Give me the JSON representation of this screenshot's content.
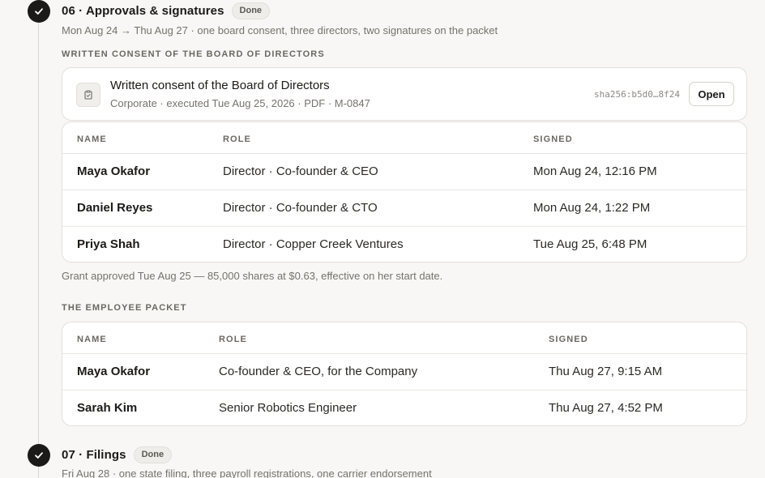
{
  "step06": {
    "title": "06 · Approvals & signatures",
    "badge": "Done",
    "subtitle": "Mon Aug 24 → Thu Aug 27 · one board consent, three directors, two signatures on the packet"
  },
  "board_section": {
    "label": "WRITTEN CONSENT OF THE BOARD OF DIRECTORS",
    "doc": {
      "icon": "clipboard-check-icon",
      "title": "Written consent of the Board of Directors",
      "meta": "Corporate · executed Tue Aug 25, 2026 · PDF · M-0847",
      "hash": "sha256:b5d0…8f24",
      "open_label": "Open"
    },
    "columns": [
      "NAME",
      "ROLE",
      "SIGNED"
    ],
    "rows": [
      {
        "name": "Maya Okafor",
        "role": "Director · Co-founder & CEO",
        "signed": "Mon Aug 24, 12:16 PM"
      },
      {
        "name": "Daniel Reyes",
        "role": "Director · Co-founder & CTO",
        "signed": "Mon Aug 24, 1:22 PM"
      },
      {
        "name": "Priya Shah",
        "role": "Director · Copper Creek Ventures",
        "signed": "Tue Aug 25, 6:48 PM"
      }
    ],
    "note": "Grant approved Tue Aug 25 — 85,000 shares at $0.63, effective on her start date."
  },
  "packet_section": {
    "label": "THE EMPLOYEE PACKET",
    "columns": [
      "NAME",
      "ROLE",
      "SIGNED"
    ],
    "rows": [
      {
        "name": "Maya Okafor",
        "role": "Co-founder & CEO, for the Company",
        "signed": "Thu Aug 27, 9:15 AM"
      },
      {
        "name": "Sarah Kim",
        "role": "Senior Robotics Engineer",
        "signed": "Thu Aug 27, 4:52 PM"
      }
    ]
  },
  "step07": {
    "title": "07 · Filings",
    "badge": "Done",
    "subtitle": "Fri Aug 28 · one state filing, three payroll registrations, one carrier endorsement"
  },
  "icons": {
    "step_status": "check-icon"
  }
}
